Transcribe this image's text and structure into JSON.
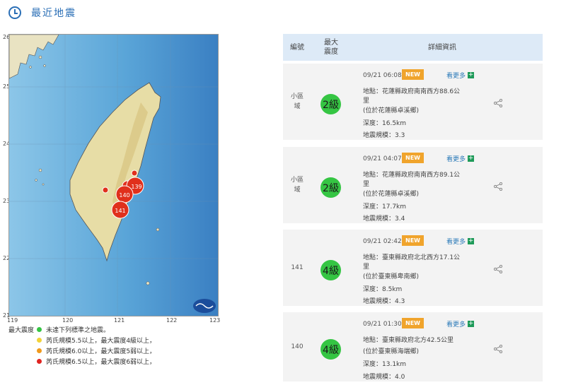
{
  "header": {
    "title": "最近地震"
  },
  "map": {
    "y_ticks": [
      "26",
      "25",
      "24",
      "23",
      "22",
      "21"
    ],
    "x_ticks": [
      "119",
      "120",
      "121",
      "122",
      "123"
    ],
    "markers": [
      "139",
      "140",
      "141"
    ]
  },
  "legend": {
    "title": "最大震度",
    "items": [
      {
        "text": "未達下列標準之地震。",
        "color": "#35c543"
      },
      {
        "text": "芮氏規模5.5以上，最大震度4級以上，",
        "color": "#f2d23a"
      },
      {
        "text": "芮氏規模6.0以上，最大震度5弱以上，",
        "color": "#f09a1c"
      },
      {
        "text": "芮氏規模6.5以上，最大震度6弱以上，",
        "color": "#e02420"
      }
    ]
  },
  "table": {
    "headers": {
      "id": "編號",
      "intensity_l1": "最大",
      "intensity_l2": "震度",
      "details": "詳細資訊"
    },
    "more_label": "看更多",
    "new_label": "NEW",
    "rows": [
      {
        "id_l1": "小區",
        "id_l2": "域",
        "intensity": "2級",
        "time": "09/21 06:08",
        "location": "地點：花蓮縣政府南南西方88.6公",
        "location2": "里",
        "area": "(位於花蓮縣卓溪鄉)",
        "depth": "深度：16.5km",
        "magnitude": "地震規模：3.3"
      },
      {
        "id_l1": "小區",
        "id_l2": "域",
        "intensity": "2級",
        "time": "09/21 04:07",
        "location": "地點：花蓮縣政府南南西方89.1公",
        "location2": "里",
        "area": "(位於花蓮縣卓溪鄉)",
        "depth": "深度：17.7km",
        "magnitude": "地震規模：3.4"
      },
      {
        "id_l1": "141",
        "id_l2": "",
        "intensity": "4級",
        "time": "09/21 02:42",
        "location": "地點：臺東縣政府北北西方17.1公",
        "location2": "里",
        "area": "(位於臺東縣卑南鄉)",
        "depth": "深度：8.5km",
        "magnitude": "地震規模：4.3"
      },
      {
        "id_l1": "140",
        "id_l2": "",
        "intensity": "4級",
        "time": "09/21 01:30",
        "location": "地點：臺東縣政府北方42.5公里",
        "location2": "",
        "area": "(位於臺東縣海端鄉)",
        "depth": "深度：13.1km",
        "magnitude": "地震規模：4.0"
      }
    ]
  }
}
